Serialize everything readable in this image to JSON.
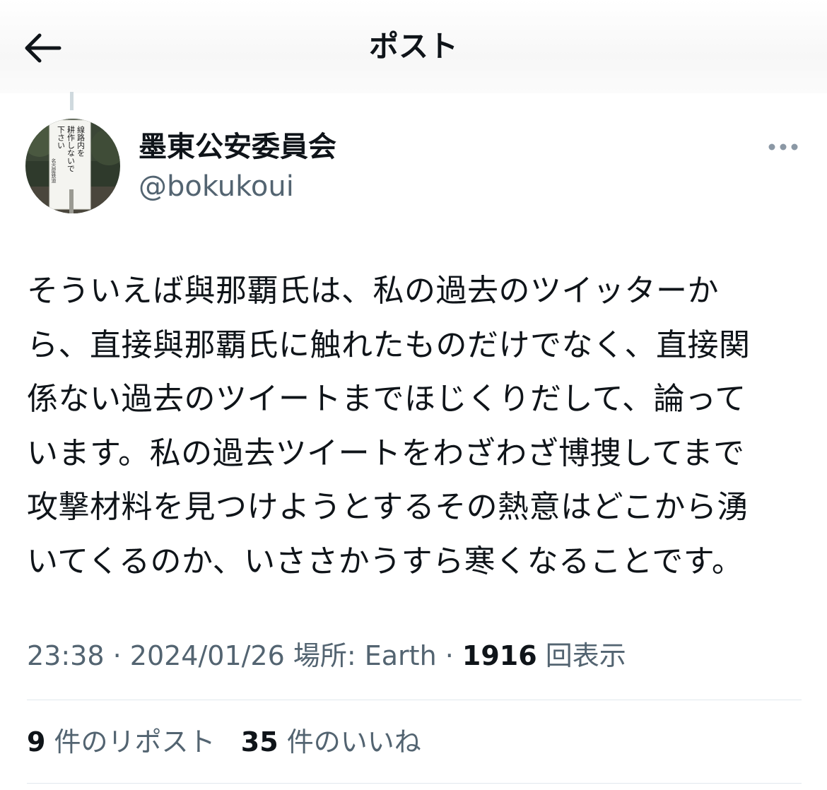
{
  "header": {
    "title": "ポスト",
    "back_icon": "arrow-left-icon"
  },
  "author": {
    "display_name": "墨東公安委員会",
    "handle": "@bokukoui",
    "avatar_sign_lines": [
      "線路内を",
      "耕作しないで",
      "下さい",
      "名古屋鉄道"
    ]
  },
  "more_icon": "more-horizontal-icon",
  "tweet": {
    "lines": [
      "そういえば與那覇氏は、私の過去のツイッターか",
      "ら、直接與那覇氏に触れたものだけでなく、直接関",
      "係ない過去のツイートまでほじくりだして、論って",
      "います。私の過去ツイートをわざわざ博捜してまで",
      "攻撃材料を見つけようとするその熱意はどこから湧",
      "いてくるのか、いささかうすら寒くなることです。"
    ]
  },
  "meta": {
    "time": "23:38",
    "sep1": " · ",
    "date": "2024/01/26",
    "location_label": " 場所: ",
    "location": "Earth",
    "sep2": " · ",
    "views": "1916",
    "views_label": " 回表示"
  },
  "stats": {
    "reposts_count": "9",
    "reposts_label": " 件のリポスト",
    "likes_count": "35",
    "likes_label": " 件のいいね"
  },
  "colors": {
    "text_primary": "#0f1419",
    "text_secondary": "#536471",
    "divider": "#e1e8ed",
    "thread_line": "#cfd9de"
  }
}
